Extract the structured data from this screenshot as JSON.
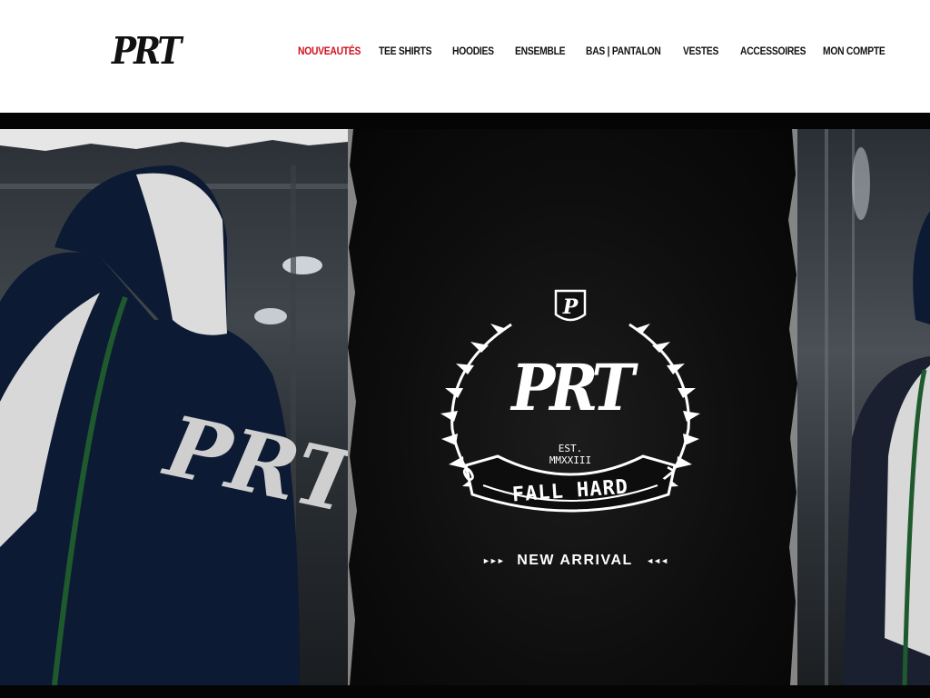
{
  "brand": {
    "logo_text": "PRT"
  },
  "nav": {
    "items": [
      {
        "label": "NOUVEAUTÉS",
        "active": true
      },
      {
        "label": "TEE SHIRTS",
        "active": false
      },
      {
        "label": "HOODIES",
        "active": false
      },
      {
        "label": "ENSEMBLE",
        "active": false
      },
      {
        "label": "BAS | PANTALON",
        "active": false
      },
      {
        "label": "VESTES",
        "active": false
      },
      {
        "label": "ACCESSOIRES",
        "active": false
      },
      {
        "label": "MON COMPTE",
        "active": false
      }
    ]
  },
  "hero": {
    "emblem": {
      "monogram": "P",
      "logo": "PRT",
      "est_line1": "EST.",
      "est_line2": "MMXXIII",
      "digit_left": "0",
      "digit_right": "7",
      "banner": "FALL HARD"
    },
    "cta": {
      "arrows_left": "►►►",
      "label": "NEW ARRIVAL",
      "arrows_right": "◄◄◄"
    }
  },
  "colors": {
    "accent": "#d0101b",
    "text": "#111111",
    "hero_bg": "#0b0b0b"
  }
}
